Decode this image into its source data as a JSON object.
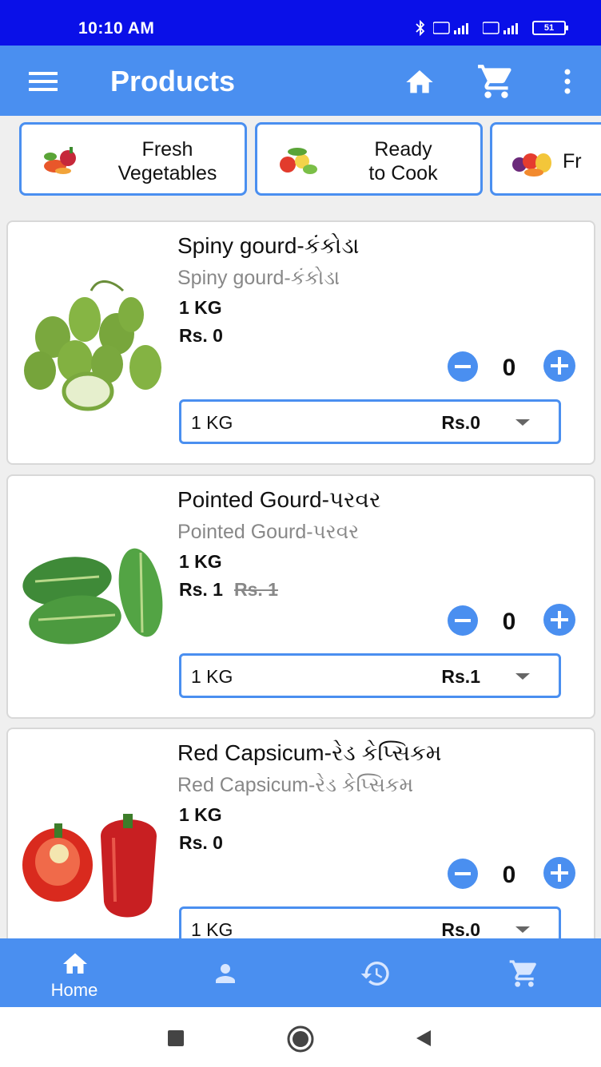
{
  "status_bar": {
    "time": "10:10 AM",
    "battery": "51"
  },
  "app_bar": {
    "title": "Products",
    "icons": [
      "menu-icon",
      "home-icon",
      "cart-icon",
      "more-vert-icon"
    ]
  },
  "categories": [
    {
      "label": "Fresh Vegetables",
      "icon": "vegetables-thumbnail"
    },
    {
      "label": "Ready to Cook",
      "icon": "ready-to-cook-thumbnail"
    },
    {
      "label": "Fr",
      "icon": "fruits-thumbnail"
    }
  ],
  "products": [
    {
      "name": "Spiny gourd-કંકોડા",
      "subname": "Spiny gourd-કંકોડા",
      "unit": "1 KG",
      "price": "Rs. 0",
      "mrp": "",
      "qty": "0",
      "select_unit": "1 KG",
      "select_price": "Rs.0"
    },
    {
      "name": "Pointed Gourd-પરવર",
      "subname": "Pointed Gourd-પરવર",
      "unit": "1 KG",
      "price": "Rs. 1",
      "mrp": "Rs. 1",
      "qty": "0",
      "select_unit": "1 KG",
      "select_price": "Rs.1"
    },
    {
      "name": "Red Capsicum-રેડ કેપ્સિકમ",
      "subname": "Red Capsicum-રેડ કેપ્સિકમ",
      "unit": "1 KG",
      "price": "Rs. 0",
      "mrp": "",
      "qty": "0",
      "select_unit": "1 KG",
      "select_price": "Rs.0"
    }
  ],
  "bottom_nav": {
    "items": [
      {
        "label": "Home",
        "icon": "home-icon",
        "active": true
      },
      {
        "label": "",
        "icon": "person-icon"
      },
      {
        "label": "",
        "icon": "history-icon"
      },
      {
        "label": "",
        "icon": "cart-icon"
      }
    ]
  },
  "colors": {
    "status_bar": "#0a10e8",
    "primary": "#4a8ff0",
    "background": "#efefef"
  }
}
